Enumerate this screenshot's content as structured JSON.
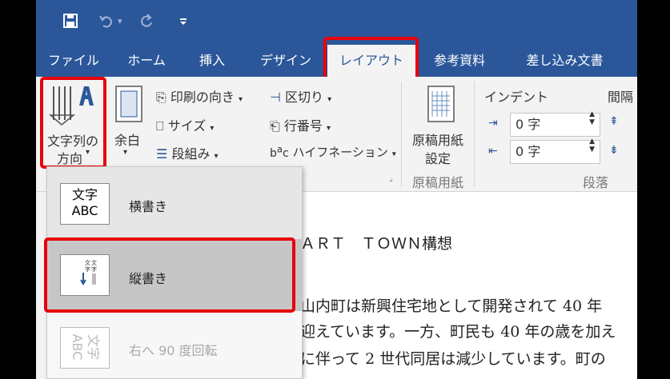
{
  "quick_access": {
    "save_icon": "save-icon",
    "undo_icon": "undo-icon",
    "undo_arrow": "▾",
    "redo_icon": "redo-icon",
    "customize_icon": "customize-qat-icon"
  },
  "tabs": [
    {
      "label": "ファイル"
    },
    {
      "label": "ホーム"
    },
    {
      "label": "挿入"
    },
    {
      "label": "デザイン"
    },
    {
      "label": "レイアウト"
    },
    {
      "label": "参考資料"
    },
    {
      "label": "差し込み文書"
    }
  ],
  "ribbon": {
    "text_direction": {
      "line1": "文字列の",
      "line2": "方向"
    },
    "margins": {
      "label": "余白"
    },
    "orientation": {
      "label": "印刷の向き"
    },
    "size": {
      "label": "サイズ"
    },
    "columns": {
      "label": "段組み"
    },
    "breaks": {
      "label": "区切り"
    },
    "line_numbers": {
      "label": "行番号"
    },
    "hyphenation": {
      "label": "ハイフネーション"
    },
    "manuscript": {
      "line1": "原稿用紙",
      "line2": "設定",
      "group": "原稿用紙"
    },
    "indent": {
      "label": "インデント",
      "left": "0 字",
      "right": "0 字"
    },
    "spacing": {
      "label": "間隔"
    },
    "paragraph_group": "段落"
  },
  "dropdown": {
    "items": [
      {
        "label": "横書き",
        "thumb_line1": "文字",
        "thumb_line2": "ABC"
      },
      {
        "label": "縦書き"
      },
      {
        "label": "右へ 90 度回転",
        "thumb_line1": "文字",
        "thumb_line2": "ABC"
      }
    ]
  },
  "document": {
    "line1": "ＡＲＴ　ＴＯＷＮ構想",
    "line2": "山内町は新興住宅地として開発されて 40 年",
    "line3": "迎えています。一方、町民も 40 年の歳を加え",
    "line4": "に伴って 2 世代同居は減少しています。町の"
  },
  "colors": {
    "word_blue": "#2b579a",
    "highlight_red": "#e8000b"
  }
}
